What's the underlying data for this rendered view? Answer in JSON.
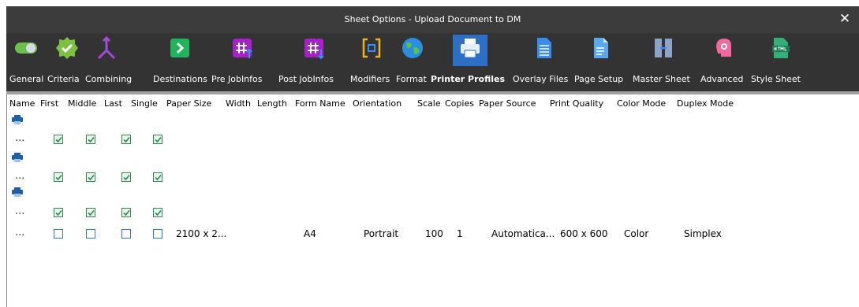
{
  "window": {
    "title": "Sheet Options - Upload Document to DM",
    "close_glyph": "✕"
  },
  "toolbar": {
    "active": "Printer Profiles",
    "items": [
      {
        "label": "General",
        "icon": "toggle-icon"
      },
      {
        "label": "Criteria",
        "icon": "check-badge-icon"
      },
      {
        "label": "Combining",
        "icon": "merge-arrows-icon"
      },
      {
        "label": "Destinations",
        "icon": "arrow-box-icon"
      },
      {
        "label": "Pre JobInfos",
        "icon": "hash-up-icon"
      },
      {
        "label": "Post JobInfos",
        "icon": "hash-down-icon"
      },
      {
        "label": "Modifiers",
        "icon": "brackets-icon"
      },
      {
        "label": "Format",
        "icon": "globe-icon"
      },
      {
        "label": "Printer Profiles",
        "icon": "printer-icon"
      },
      {
        "label": "Overlay Files",
        "icon": "document-icon"
      },
      {
        "label": "Page Setup",
        "icon": "page-icon"
      },
      {
        "label": "Master Sheet",
        "icon": "master-sheet-icon"
      },
      {
        "label": "Advanced",
        "icon": "head-gear-icon"
      },
      {
        "label": "Style Sheet",
        "icon": "html-file-icon"
      }
    ]
  },
  "grid": {
    "columns": [
      "Name",
      "First",
      "Middle",
      "Last",
      "Single",
      "Paper Size",
      "Width",
      "Length",
      "Form Name",
      "Orientation",
      "Scale",
      "Copies",
      "Paper Source",
      "Print Quality",
      "Color Mode",
      "Duplex Mode"
    ],
    "rows": [
      {
        "group_icon": "printer-icon",
        "name": "...",
        "first": true,
        "middle": true,
        "last": true,
        "single": true
      },
      {
        "group_icon": "printer-icon",
        "name": "...",
        "first": true,
        "middle": true,
        "last": true,
        "single": true
      },
      {
        "group_icon": "printer-icon",
        "name": "...",
        "first": true,
        "middle": true,
        "last": true,
        "single": true
      },
      {
        "name": "...",
        "first": false,
        "middle": false,
        "last": false,
        "single": false,
        "paper_size": "2100 x 2...",
        "form_name": "A4",
        "orientation": "Portrait",
        "scale": "100",
        "copies": "1",
        "paper_source": "Automatica...",
        "print_quality": "600 x 600",
        "color_mode": "Color",
        "duplex_mode": "Simplex"
      }
    ]
  },
  "colors": {
    "titlebar": "#3c3c3c",
    "toolbar": "#333333",
    "active_tab": "#2d6fc4",
    "check_green": "#2e8b57",
    "check_blue": "#2b7bd9"
  }
}
